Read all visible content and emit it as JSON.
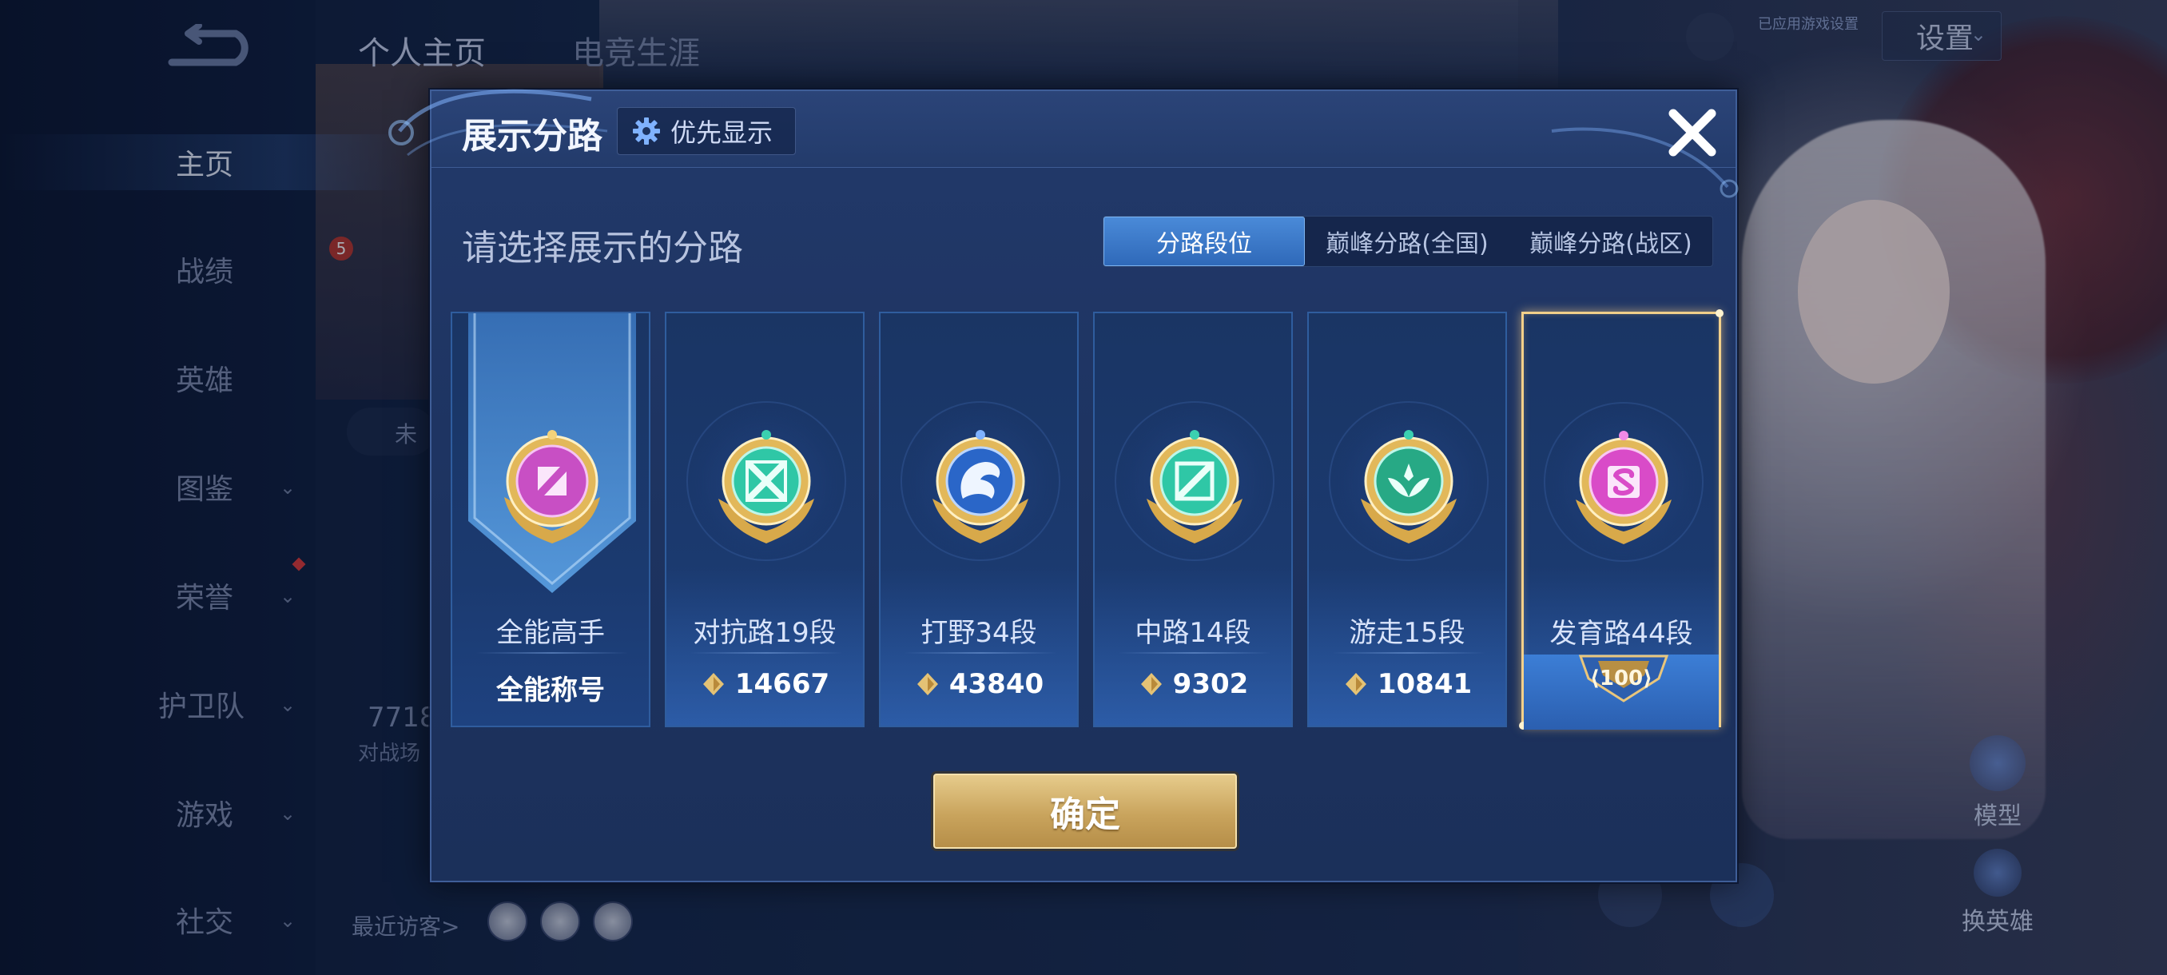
{
  "sidebar": {
    "items": [
      {
        "label": "主页",
        "active": true
      },
      {
        "label": "战绩"
      },
      {
        "label": "英雄"
      },
      {
        "label": "图鉴"
      },
      {
        "label": "荣誉"
      },
      {
        "label": "护卫队"
      },
      {
        "label": "游戏"
      },
      {
        "label": "社交"
      }
    ]
  },
  "top": {
    "tab_profile": "个人主页",
    "tab_career": "电竞生涯",
    "settings_label": "设置",
    "note": "已应用游戏设置"
  },
  "background": {
    "visitors_label": "最近访客>",
    "rank_number": "5",
    "count_text": "7718",
    "count_sub": "对战场",
    "chip_text": "未",
    "model_label": "模型",
    "swap_hero_label": "换英雄"
  },
  "modal": {
    "title": "展示分路",
    "priority_label": "优先显示",
    "subtitle": "请选择展示的分路",
    "segments": [
      {
        "label": "分路段位",
        "active": true
      },
      {
        "label": "巅峰分路(全国)"
      },
      {
        "label": "巅峰分路(战区)"
      }
    ],
    "cards": [
      {
        "name": "全能高手",
        "value": "全能称号",
        "icon": "all-round-emblem-icon",
        "color": "#c84fc4"
      },
      {
        "name": "对抗路19段",
        "value": "14667",
        "icon": "clash-lane-emblem-icon",
        "color": "#2fc7a6"
      },
      {
        "name": "打野34段",
        "value": "43840",
        "icon": "jungle-emblem-icon",
        "color": "#2a66c8"
      },
      {
        "name": "中路14段",
        "value": "9302",
        "icon": "mid-lane-emblem-icon",
        "color": "#2fc7a6"
      },
      {
        "name": "游走15段",
        "value": "10841",
        "icon": "roam-emblem-icon",
        "color": "#27a985"
      },
      {
        "name": "发育路44段",
        "value": "100",
        "icon": "farm-lane-emblem-icon",
        "color": "#d94bc8",
        "selected": true
      }
    ],
    "confirm_label": "确定"
  },
  "colors": {
    "accent_gold": "#f2d08a",
    "tab_active": "#3f7dd0",
    "panel_bg": "#1d3360"
  }
}
